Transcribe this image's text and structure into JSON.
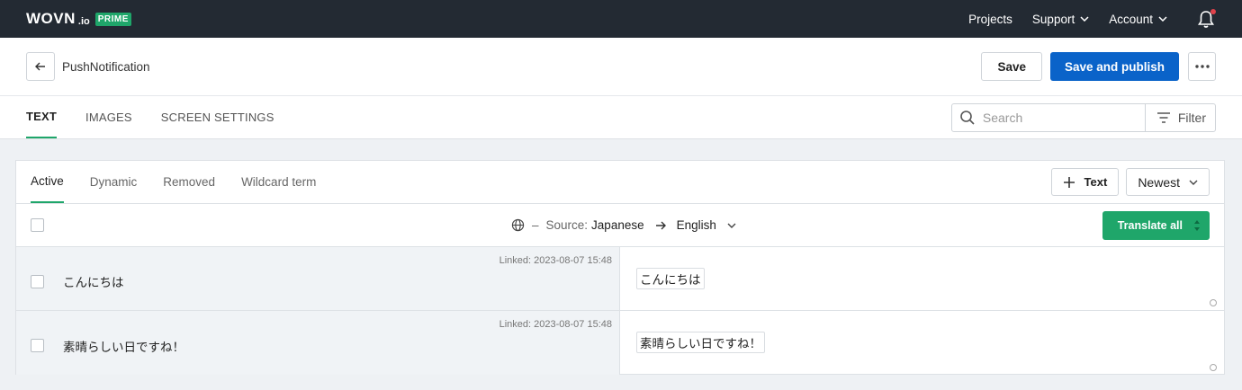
{
  "topnav": {
    "logo_main": "WOVN",
    "logo_io": ".io",
    "logo_badge": "PRIME",
    "projects": "Projects",
    "support": "Support",
    "account": "Account"
  },
  "header": {
    "title": "PushNotification",
    "save_label": "Save",
    "publish_label": "Save and publish"
  },
  "main_tabs": [
    {
      "label": "TEXT",
      "active": true
    },
    {
      "label": "IMAGES",
      "active": false
    },
    {
      "label": "SCREEN SETTINGS",
      "active": false
    }
  ],
  "search": {
    "placeholder": "Search"
  },
  "filter": {
    "label": "Filter"
  },
  "sub_tabs": [
    {
      "label": "Active",
      "active": true
    },
    {
      "label": "Dynamic",
      "active": false
    },
    {
      "label": "Removed",
      "active": false
    },
    {
      "label": "Wildcard term",
      "active": false
    }
  ],
  "actions": {
    "add_text_label": "Text",
    "sort_label": "Newest"
  },
  "language": {
    "dash": "–",
    "source_label": "Source:",
    "source_value": "Japanese",
    "target_value": "English",
    "translate_all_label": "Translate all"
  },
  "rows": [
    {
      "linked": "Linked: 2023-08-07 15:48",
      "source": "こんにちは",
      "target": "こんにちは"
    },
    {
      "linked": "Linked: 2023-08-07 15:48",
      "source": "素晴らしい日ですね！",
      "target": "素晴らしい日ですね！"
    }
  ],
  "colors": {
    "nav_bg": "#232a33",
    "brand_green": "#1fa66a",
    "primary_blue": "#0a63c9",
    "notification_red": "#e0424b"
  }
}
